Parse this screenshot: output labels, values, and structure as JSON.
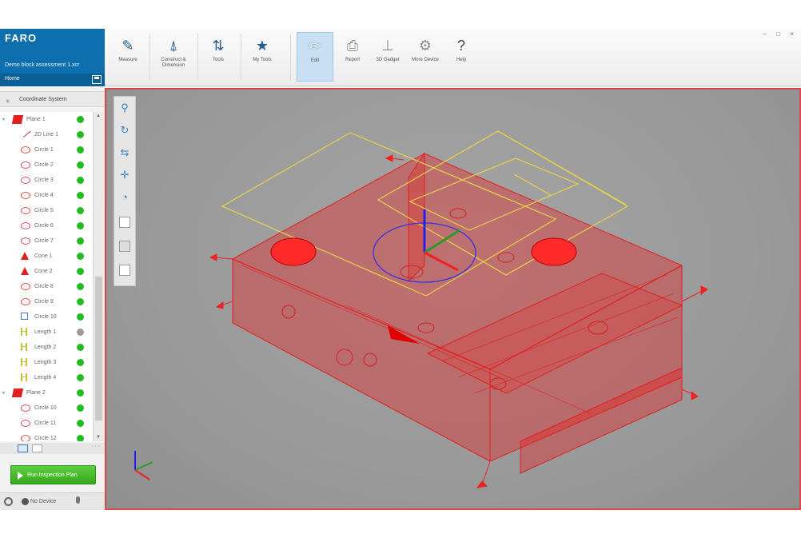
{
  "brand": {
    "logo": "FARO",
    "project": "Demo block assessment 1.xcr",
    "home_label": "Home"
  },
  "coord_system": {
    "label": "Coordinate System",
    "icon": "axes-icon"
  },
  "tree": {
    "items": [
      {
        "label": "Plane 1",
        "icon": "plane-icon",
        "level": 0,
        "expand": "▾",
        "status": "green"
      },
      {
        "label": "2D Line 1",
        "icon": "line-icon",
        "level": 1,
        "status": "green"
      },
      {
        "label": "Circle 1",
        "icon": "circle-icon",
        "level": 1,
        "status": "green"
      },
      {
        "label": "Circle 2",
        "icon": "circle-icon",
        "level": 1,
        "status": "green"
      },
      {
        "label": "Circle 3",
        "icon": "circle-icon",
        "level": 1,
        "status": "green"
      },
      {
        "label": "Circle 4",
        "icon": "circle-icon",
        "level": 1,
        "status": "green"
      },
      {
        "label": "Circle 5",
        "icon": "circle-icon",
        "level": 1,
        "status": "green"
      },
      {
        "label": "Circle 6",
        "icon": "circle-icon",
        "level": 1,
        "status": "green"
      },
      {
        "label": "Circle 7",
        "icon": "circle-icon",
        "level": 1,
        "status": "green"
      },
      {
        "label": "Cone 1",
        "icon": "cone-icon",
        "level": 1,
        "status": "green"
      },
      {
        "label": "Cone 2",
        "icon": "cone-icon",
        "level": 1,
        "status": "green"
      },
      {
        "label": "Circle 8",
        "icon": "circle-icon",
        "level": 1,
        "status": "green"
      },
      {
        "label": "Circle 9",
        "icon": "circle-icon",
        "level": 1,
        "status": "green"
      },
      {
        "label": "Circle 10",
        "icon": "square-icon",
        "level": 1,
        "status": "green"
      },
      {
        "label": "Length 1",
        "icon": "length-icon",
        "level": 1,
        "status": "grey"
      },
      {
        "label": "Length 2",
        "icon": "length-icon",
        "level": 1,
        "status": "green"
      },
      {
        "label": "Length 3",
        "icon": "length-icon",
        "level": 1,
        "status": "green"
      },
      {
        "label": "Length 4",
        "icon": "length-icon",
        "level": 1,
        "status": "green"
      },
      {
        "label": "Plane 2",
        "icon": "plane-icon",
        "level": 0,
        "expand": "▾",
        "status": "green"
      },
      {
        "label": "Circle 10",
        "icon": "circle-icon",
        "level": 1,
        "status": "green"
      },
      {
        "label": "Circle 11",
        "icon": "circle-icon",
        "level": 1,
        "status": "green"
      },
      {
        "label": "Circle 12",
        "icon": "circle-icon",
        "level": 1,
        "status": "green"
      }
    ]
  },
  "tree_tabs": {
    "more": "· · ·"
  },
  "run_button": {
    "label": "Run Inspection Plan"
  },
  "status_bar": {
    "device": "No Device"
  },
  "ribbon": {
    "buttons": [
      {
        "id": "measure",
        "label": "Measure",
        "icon": "ruler-icon",
        "glyph": "✎"
      },
      {
        "id": "construct",
        "label": "Construct & Dimension",
        "icon": "compass-icon",
        "glyph": "⍋"
      },
      {
        "id": "tools",
        "label": "Tools",
        "icon": "tools-icon",
        "glyph": "⇅"
      },
      {
        "id": "mytools",
        "label": "My Tools",
        "icon": "star-icon",
        "glyph": "★"
      },
      {
        "id": "edit",
        "label": "Edit",
        "icon": "pencil-icon",
        "glyph": "✏"
      },
      {
        "id": "report",
        "label": "Report",
        "icon": "printer-icon",
        "glyph": "⎙"
      },
      {
        "id": "gadget",
        "label": "3D Gadget",
        "icon": "gadget-icon",
        "glyph": "⊥"
      },
      {
        "id": "device",
        "label": "More Device",
        "icon": "device-icon",
        "glyph": "⚙"
      },
      {
        "id": "help",
        "label": "Help",
        "icon": "help-icon",
        "glyph": "?"
      }
    ],
    "window_controls": "– □ ×"
  },
  "view_tools": [
    {
      "name": "zoom-icon",
      "glyph": "⚲"
    },
    {
      "name": "rotate-icon",
      "glyph": "↻"
    },
    {
      "name": "pan-icon",
      "glyph": "⇆"
    },
    {
      "name": "move-icon",
      "glyph": "✛"
    },
    {
      "name": "fit-view-icon",
      "glyph": "◔"
    }
  ],
  "colors": {
    "accent": "#0e6fae",
    "feature": "#e32020",
    "dimension": "#e8d24a",
    "status_ok": "#22bb22",
    "viewport_border": "#d94848"
  }
}
